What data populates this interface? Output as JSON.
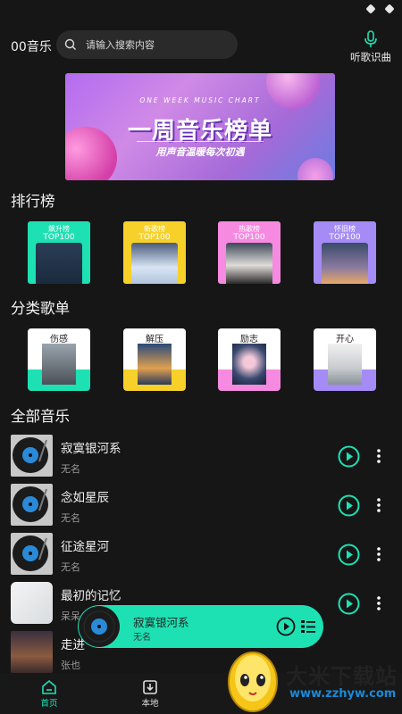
{
  "header": {
    "app_title": "00音乐",
    "search_placeholder": "请输入搜索内容",
    "mic_label": "听歌识曲"
  },
  "banner": {
    "subtitle_en": "ONE WEEK MUSIC CHART",
    "title": "一周音乐榜单",
    "tagline": "用声音温暖每次初遇"
  },
  "sections": {
    "rankings": "排行榜",
    "categories": "分类歌单",
    "all_music": "全部音乐"
  },
  "rankings": [
    {
      "label": "飙升榜",
      "sub": "TOP100",
      "color": "#1ee1b3"
    },
    {
      "label": "新歌榜",
      "sub": "TOP100",
      "color": "#f7d12a"
    },
    {
      "label": "热歌榜",
      "sub": "TOP100",
      "color": "#f58ae0"
    },
    {
      "label": "怀旧榜",
      "sub": "TOP100",
      "color": "#a58bf5"
    }
  ],
  "categories": [
    {
      "label": "伤感",
      "color": "#1ee1b3"
    },
    {
      "label": "解压",
      "color": "#f7d12a"
    },
    {
      "label": "励志",
      "color": "#f58ae0"
    },
    {
      "label": "开心",
      "color": "#a58bf5"
    }
  ],
  "songs": [
    {
      "title": "寂寞银河系",
      "artist": "无名"
    },
    {
      "title": "念如星辰",
      "artist": "无名"
    },
    {
      "title": "征途星河",
      "artist": "无名"
    },
    {
      "title": "最初的记忆",
      "artist": "呆呆"
    },
    {
      "title": "走进",
      "artist": "张也"
    }
  ],
  "mini_player": {
    "title": "寂寞银河系",
    "artist": "无名"
  },
  "nav": {
    "home": "首页",
    "local": "本地"
  },
  "watermark": {
    "name": "大米下载站",
    "url": "www.zzhyw.com"
  },
  "colors": {
    "accent": "#1ee1b3",
    "background": "#161616"
  }
}
